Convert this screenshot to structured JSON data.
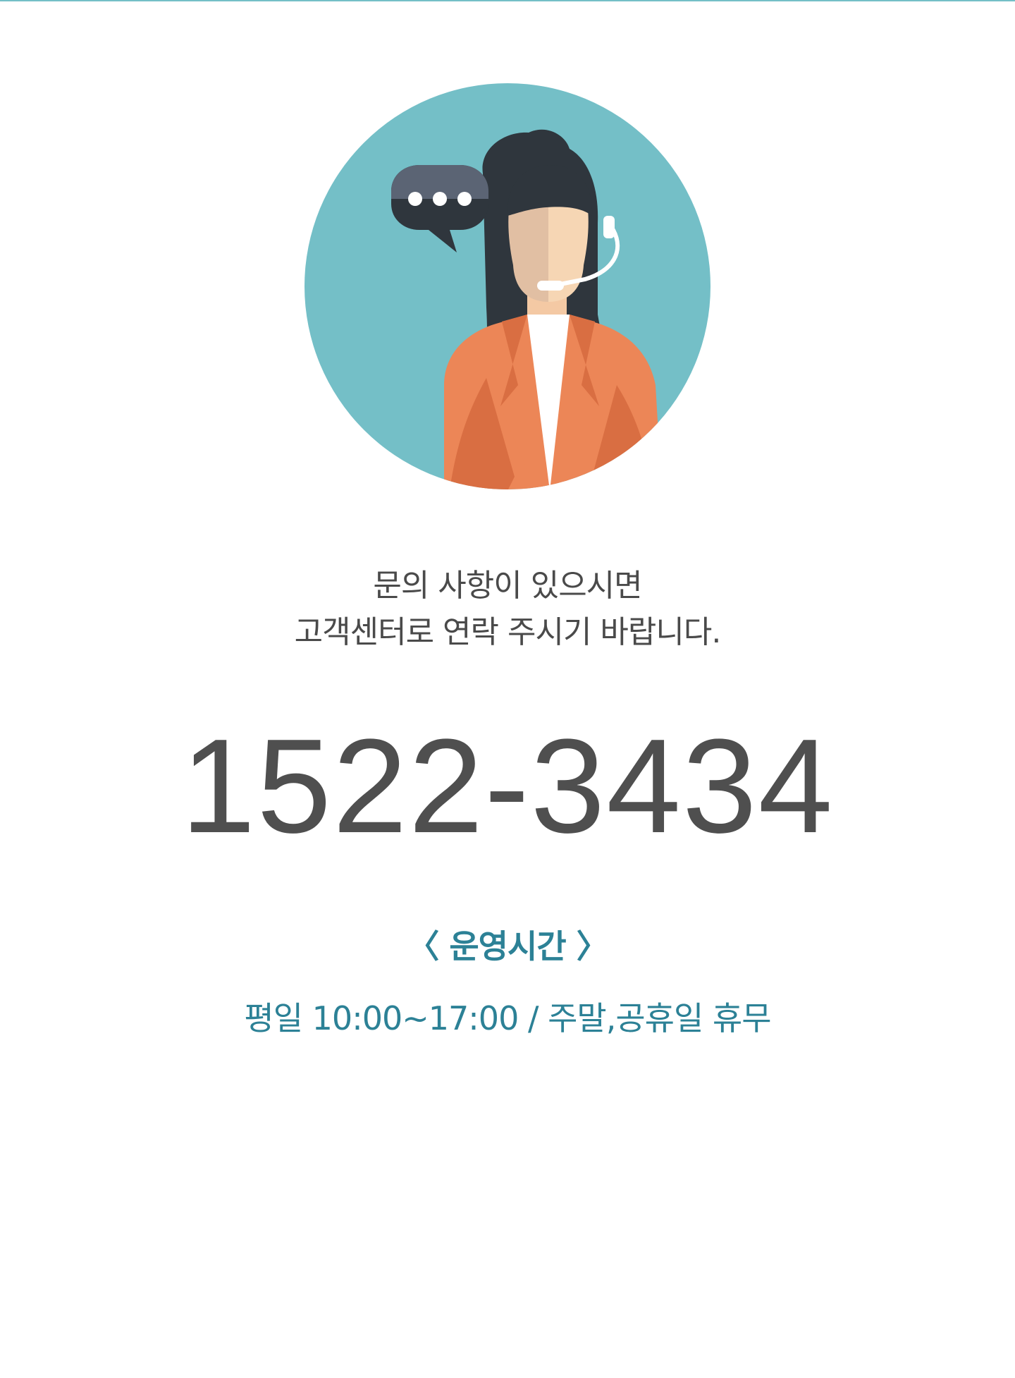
{
  "illustration": {
    "icon": "customer-service-agent-icon",
    "bubble_icon": "speech-bubble-icon",
    "colors": {
      "circle": "#74bfc7",
      "hair": "#2f363d",
      "jacket": "#ec8657",
      "bubble": "#5b6474"
    }
  },
  "intro": {
    "line1": "문의 사항이 있으시면",
    "line2": "고객센터로 연락 주시기 바랍니다."
  },
  "phone": "1522-3434",
  "hours": {
    "title": "〈 운영시간 〉",
    "detail": "평일 10:00~17:00 / 주말,공휴일 휴무"
  },
  "colors": {
    "accent": "#2c8196",
    "text": "#4a4a4a",
    "top_line": "#74bfc7"
  }
}
